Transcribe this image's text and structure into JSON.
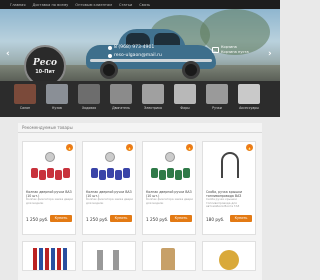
{
  "topnav": {
    "links": [
      "Главная",
      "Доставка по всему",
      "Оптовым клиентам",
      "Статьи",
      "Связь"
    ]
  },
  "header": {
    "logo_main": "Ресо",
    "logo_sub": "10-Пит",
    "phone": "8 (968) 973-4901",
    "email": "reso-ulgaon@mail.ru",
    "cart_title": "Корзина",
    "cart_status": "Корзина пуста",
    "prev_arrow": "‹",
    "next_arrow": "›"
  },
  "menu": {
    "items": [
      {
        "label": "Салон",
        "color": "#7b4a3a"
      },
      {
        "label": "Кузов",
        "color": "#8a8f96"
      },
      {
        "label": "Ходовая",
        "color": "#6d6d6d"
      },
      {
        "label": "Двигатель",
        "color": "#8b8b8b"
      },
      {
        "label": "Электрика",
        "color": "#a0a0a0"
      },
      {
        "label": "Фары",
        "color": "#b8b8b8"
      },
      {
        "label": "Ручки",
        "color": "#9a9a9a"
      },
      {
        "label": "Аксессуары",
        "color": "#c9c9c9"
      }
    ]
  },
  "section": {
    "title": "Рекомендуемые товары"
  },
  "products": [
    {
      "name": "Колпак дверной ручки ВАЗ (10 шт.)",
      "desc": "Колпак фиксатора замка двери для модели",
      "price": "1 250 руб.",
      "buy": "Купить",
      "color": "#c8323c"
    },
    {
      "name": "Колпак дверной ручки ВАЗ (10 шт.)",
      "desc": "Колпак фиксатора замка двери для модели",
      "price": "1 250 руб.",
      "buy": "Купить",
      "color": "#3a44a8"
    },
    {
      "name": "Колпак дверной ручки ВАЗ (10 шт.)",
      "desc": "Колпак фиксатора замка двери для модели",
      "price": "1 250 руб.",
      "buy": "Купить",
      "color": "#2f7a48"
    },
    {
      "name": "Скоба, ручка крышки топливопровода ВАЗ",
      "desc": "Скоба ручки крышки топливопровода для автомобиля Волга ГАЗ",
      "price": "180 руб.",
      "buy": "Купить",
      "color": "#444444"
    }
  ],
  "flame_icon": "🔥"
}
